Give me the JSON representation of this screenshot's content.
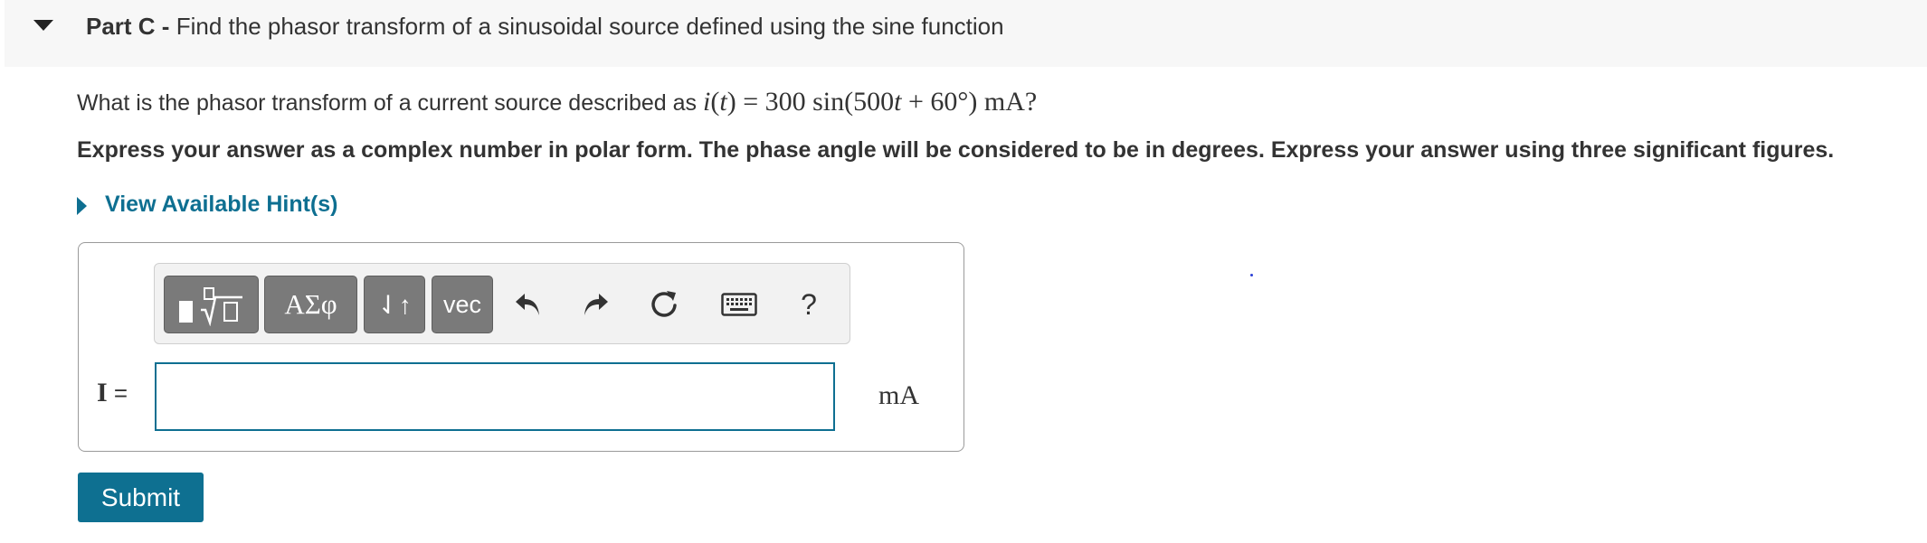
{
  "part": {
    "label": "Part C -",
    "title": "Find the phasor transform of a sinusoidal source defined using the sine function"
  },
  "question": {
    "text": "What is the phasor transform of a current source described as",
    "math": {
      "lhs_func": "i",
      "lhs_arg": "t",
      "equals": "=",
      "coefficient": "300",
      "func": "sin",
      "inner": "500",
      "inner_var": "t",
      "plus": "+",
      "angle": "60°",
      "unit": "mA",
      "end": "?"
    }
  },
  "instructions": "Express your answer as a complex number in polar form. The phase angle will be considered to be in degrees. Express your answer using three significant figures.",
  "hint": {
    "label": "View Available Hint(s)"
  },
  "toolbar": {
    "greek_label": "ΑΣφ",
    "arrows_label": "⇃↑",
    "vec_label": "vec",
    "help_label": "?"
  },
  "answer": {
    "variable": "I",
    "equals": "=",
    "value": "",
    "units": "mA"
  },
  "submit": {
    "label": "Submit"
  },
  "colors": {
    "accent": "#0e6f91",
    "header_bg": "#f7f7f7",
    "toolbar_button": "#7a7a7a"
  },
  "icons": [
    "collapse-caret-icon",
    "hint-caret-icon",
    "templates-icon",
    "undo-icon",
    "redo-icon",
    "reset-icon",
    "keyboard-icon"
  ]
}
